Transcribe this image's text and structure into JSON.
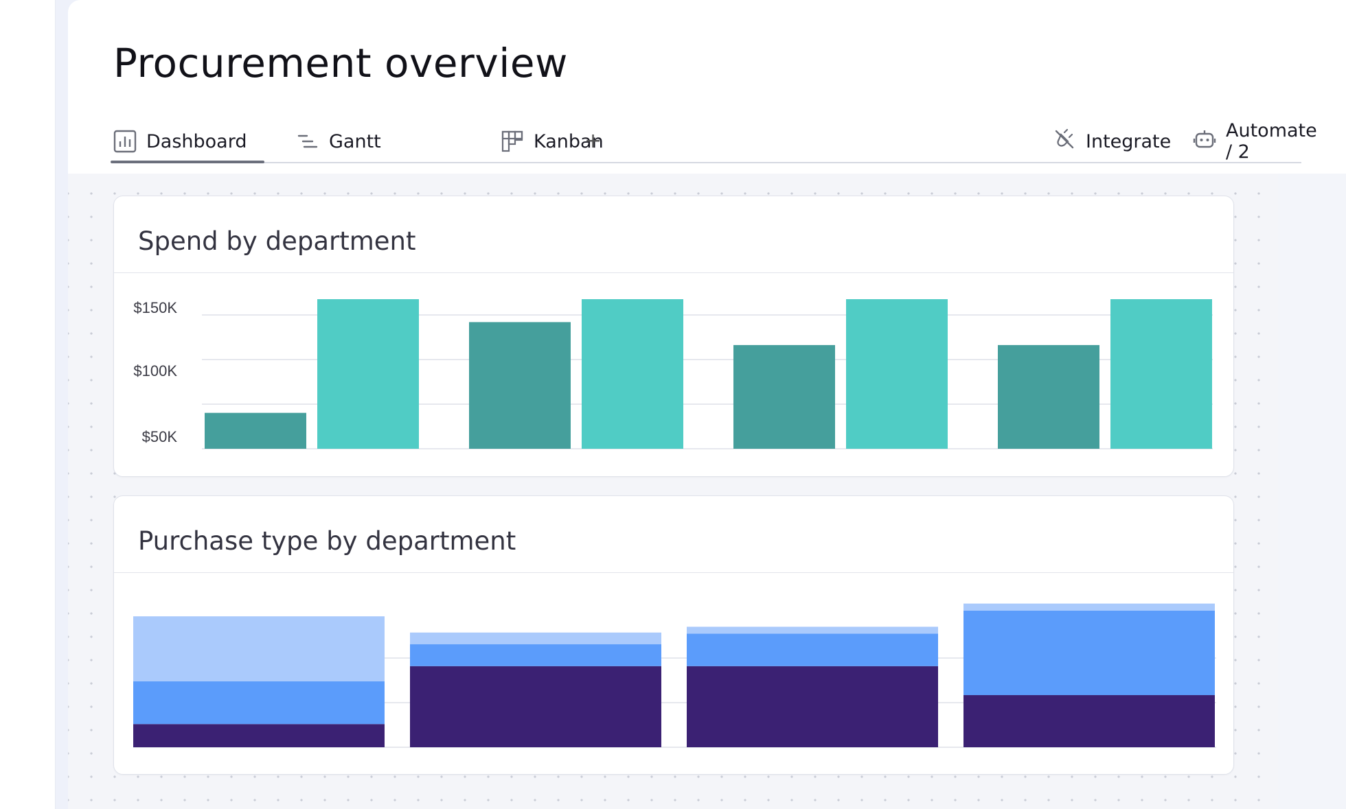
{
  "page": {
    "title": "Procurement overview"
  },
  "tabs": [
    {
      "label": "Dashboard",
      "icon": "bar-chart-icon",
      "active": true
    },
    {
      "label": "Gantt",
      "icon": "gantt-icon",
      "active": false
    },
    {
      "label": "Kanban",
      "icon": "kanban-icon",
      "active": false
    }
  ],
  "add_tab_label": "+",
  "actions": {
    "integrate": {
      "label": "Integrate",
      "icon": "integrate-plug-icon"
    },
    "automate": {
      "label": "Automate / 2",
      "icon": "robot-icon"
    }
  },
  "widgets": {
    "spend": {
      "title": "Spend by department"
    },
    "purchase": {
      "title": "Purchase type by department"
    }
  },
  "chart_data": [
    {
      "type": "bar",
      "title": "Spend by department",
      "categories": [
        "",
        "",
        "",
        ""
      ],
      "series": [
        {
          "values": [
            36,
            127,
            104,
            104
          ],
          "color": "#459f9c"
        },
        {
          "values": [
            150,
            150,
            150,
            150
          ],
          "color": "#50ccc5"
        }
      ],
      "y_ticks": [
        "$50K",
        "$100K",
        "$150K"
      ],
      "ylim": [
        0,
        150
      ],
      "grid": true
    },
    {
      "type": "bar",
      "stacked": true,
      "title": "Purchase type by department",
      "categories": [
        "",
        "",
        "",
        ""
      ],
      "series": [
        {
          "values": [
            20,
            70,
            70,
            45
          ],
          "color": "#3b2173"
        },
        {
          "values": [
            37,
            19,
            28,
            73
          ],
          "color": "#5b9cfb"
        },
        {
          "values": [
            56,
            10,
            6,
            6
          ],
          "color": "#aacafc"
        }
      ],
      "ylim": [
        0,
        122
      ],
      "grid": true
    }
  ]
}
